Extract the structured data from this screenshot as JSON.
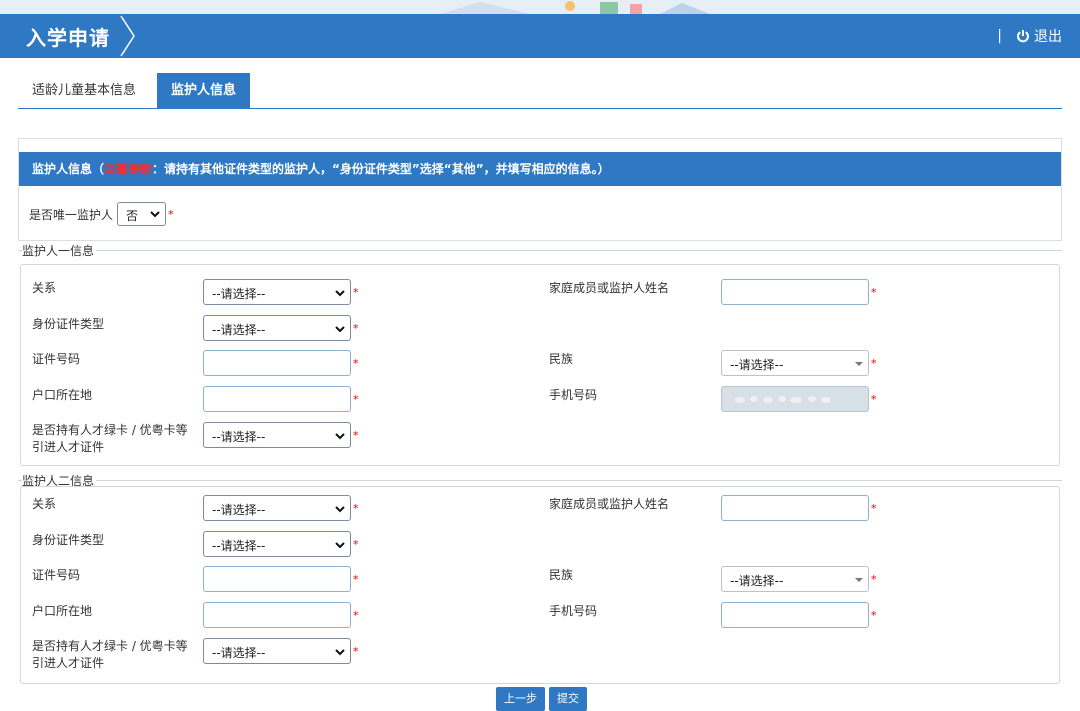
{
  "header": {
    "title": "入学申请",
    "separator": "|",
    "logout_label": "退出"
  },
  "tabs": [
    {
      "label": "适龄儿童基本信息",
      "active": false
    },
    {
      "label": "监护人信息",
      "active": true
    }
  ],
  "notice": {
    "prefix": "监护人信息（",
    "warn_label": "温馨提醒",
    "text": "：请持有其他证件类型的监护人，“身份证件类型”选择“其他”，并填写相应的信息。）"
  },
  "only_guardian": {
    "label": "是否唯一监护人",
    "value": "否",
    "required_mark": "*"
  },
  "required_mark": "*",
  "select_placeholder": "--请选择--",
  "guardian1": {
    "legend": "监护人一信息",
    "relation_label": "关系",
    "name_label": "家庭成员或监护人姓名",
    "id_type_label": "身份证件类型",
    "id_number_label": "证件号码",
    "nation_label": "民族",
    "hukou_label": "户口所在地",
    "phone_label": "手机号码",
    "talent_label_1": "是否持有人才绿卡 / 优粤卡等",
    "talent_label_2": "引进人才证件"
  },
  "guardian2": {
    "legend": "监护人二信息",
    "relation_label": "关系",
    "name_label": "家庭成员或监护人姓名",
    "id_type_label": "身份证件类型",
    "id_number_label": "证件号码",
    "nation_label": "民族",
    "hukou_label": "户口所在地",
    "phone_label": "手机号码",
    "talent_label_1": "是否持有人才绿卡 / 优粤卡等",
    "talent_label_2": "引进人才证件"
  },
  "buttons": {
    "prev_label": "上一步",
    "submit_label": "提交"
  },
  "colors": {
    "primary": "#2f78c4",
    "warn": "#ff2a2a",
    "required": "#e00000"
  }
}
